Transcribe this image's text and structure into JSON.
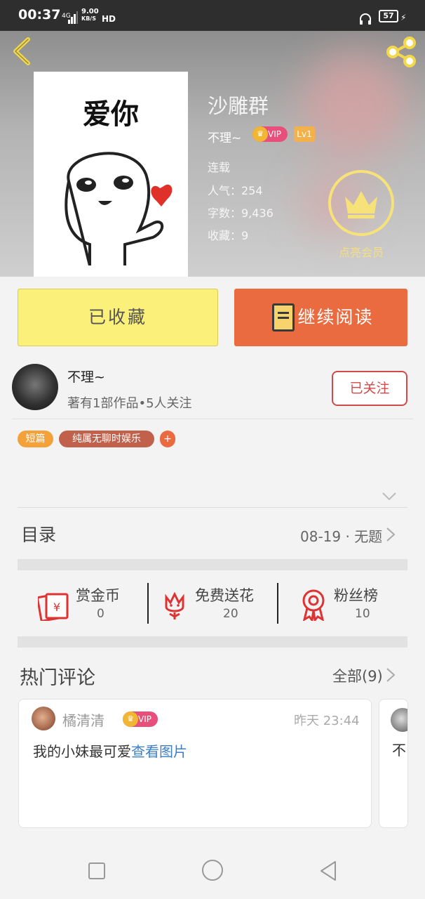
{
  "status_bar": {
    "time": "00:37",
    "network": "4G",
    "speed": "9.00",
    "speed_unit": "KB/S",
    "hd": "HD",
    "battery": "57"
  },
  "book": {
    "cover_text": "爱你",
    "title": "沙雕群",
    "author": "不理~",
    "vip": "VIP",
    "level": "Lv1",
    "status": "连载",
    "popularity": "人气：254",
    "word_count": "字数：9,436",
    "favorites": "收藏：9",
    "member_label": "点亮会员"
  },
  "actions": {
    "favorited": "已收藏",
    "continue_reading": "继续阅读"
  },
  "author": {
    "name": "不理~",
    "stats": "著有1部作品•5人关注",
    "follow": "已关注"
  },
  "tags": [
    "短篇",
    "纯属无聊时娱乐",
    "+"
  ],
  "toc": {
    "label": "目录",
    "latest": "08-19 · 无题"
  },
  "stats": [
    {
      "label": "赏金币",
      "value": "0"
    },
    {
      "label": "免费送花",
      "value": "20"
    },
    {
      "label": "粉丝榜",
      "value": "10"
    }
  ],
  "comments": {
    "label": "热门评论",
    "all": "全部(9)",
    "items": [
      {
        "name": "橘清清",
        "vip": "VIP",
        "time": "昨天 23:44",
        "text": "我的小妹最可爱",
        "link": "查看图片"
      },
      {
        "text": "不"
      }
    ]
  },
  "colors": {
    "accent_orange": "#ea6b3f",
    "fav_yellow": "#faf07a",
    "follow_red": "#d14a4a",
    "link_blue": "#3d7fc4"
  }
}
